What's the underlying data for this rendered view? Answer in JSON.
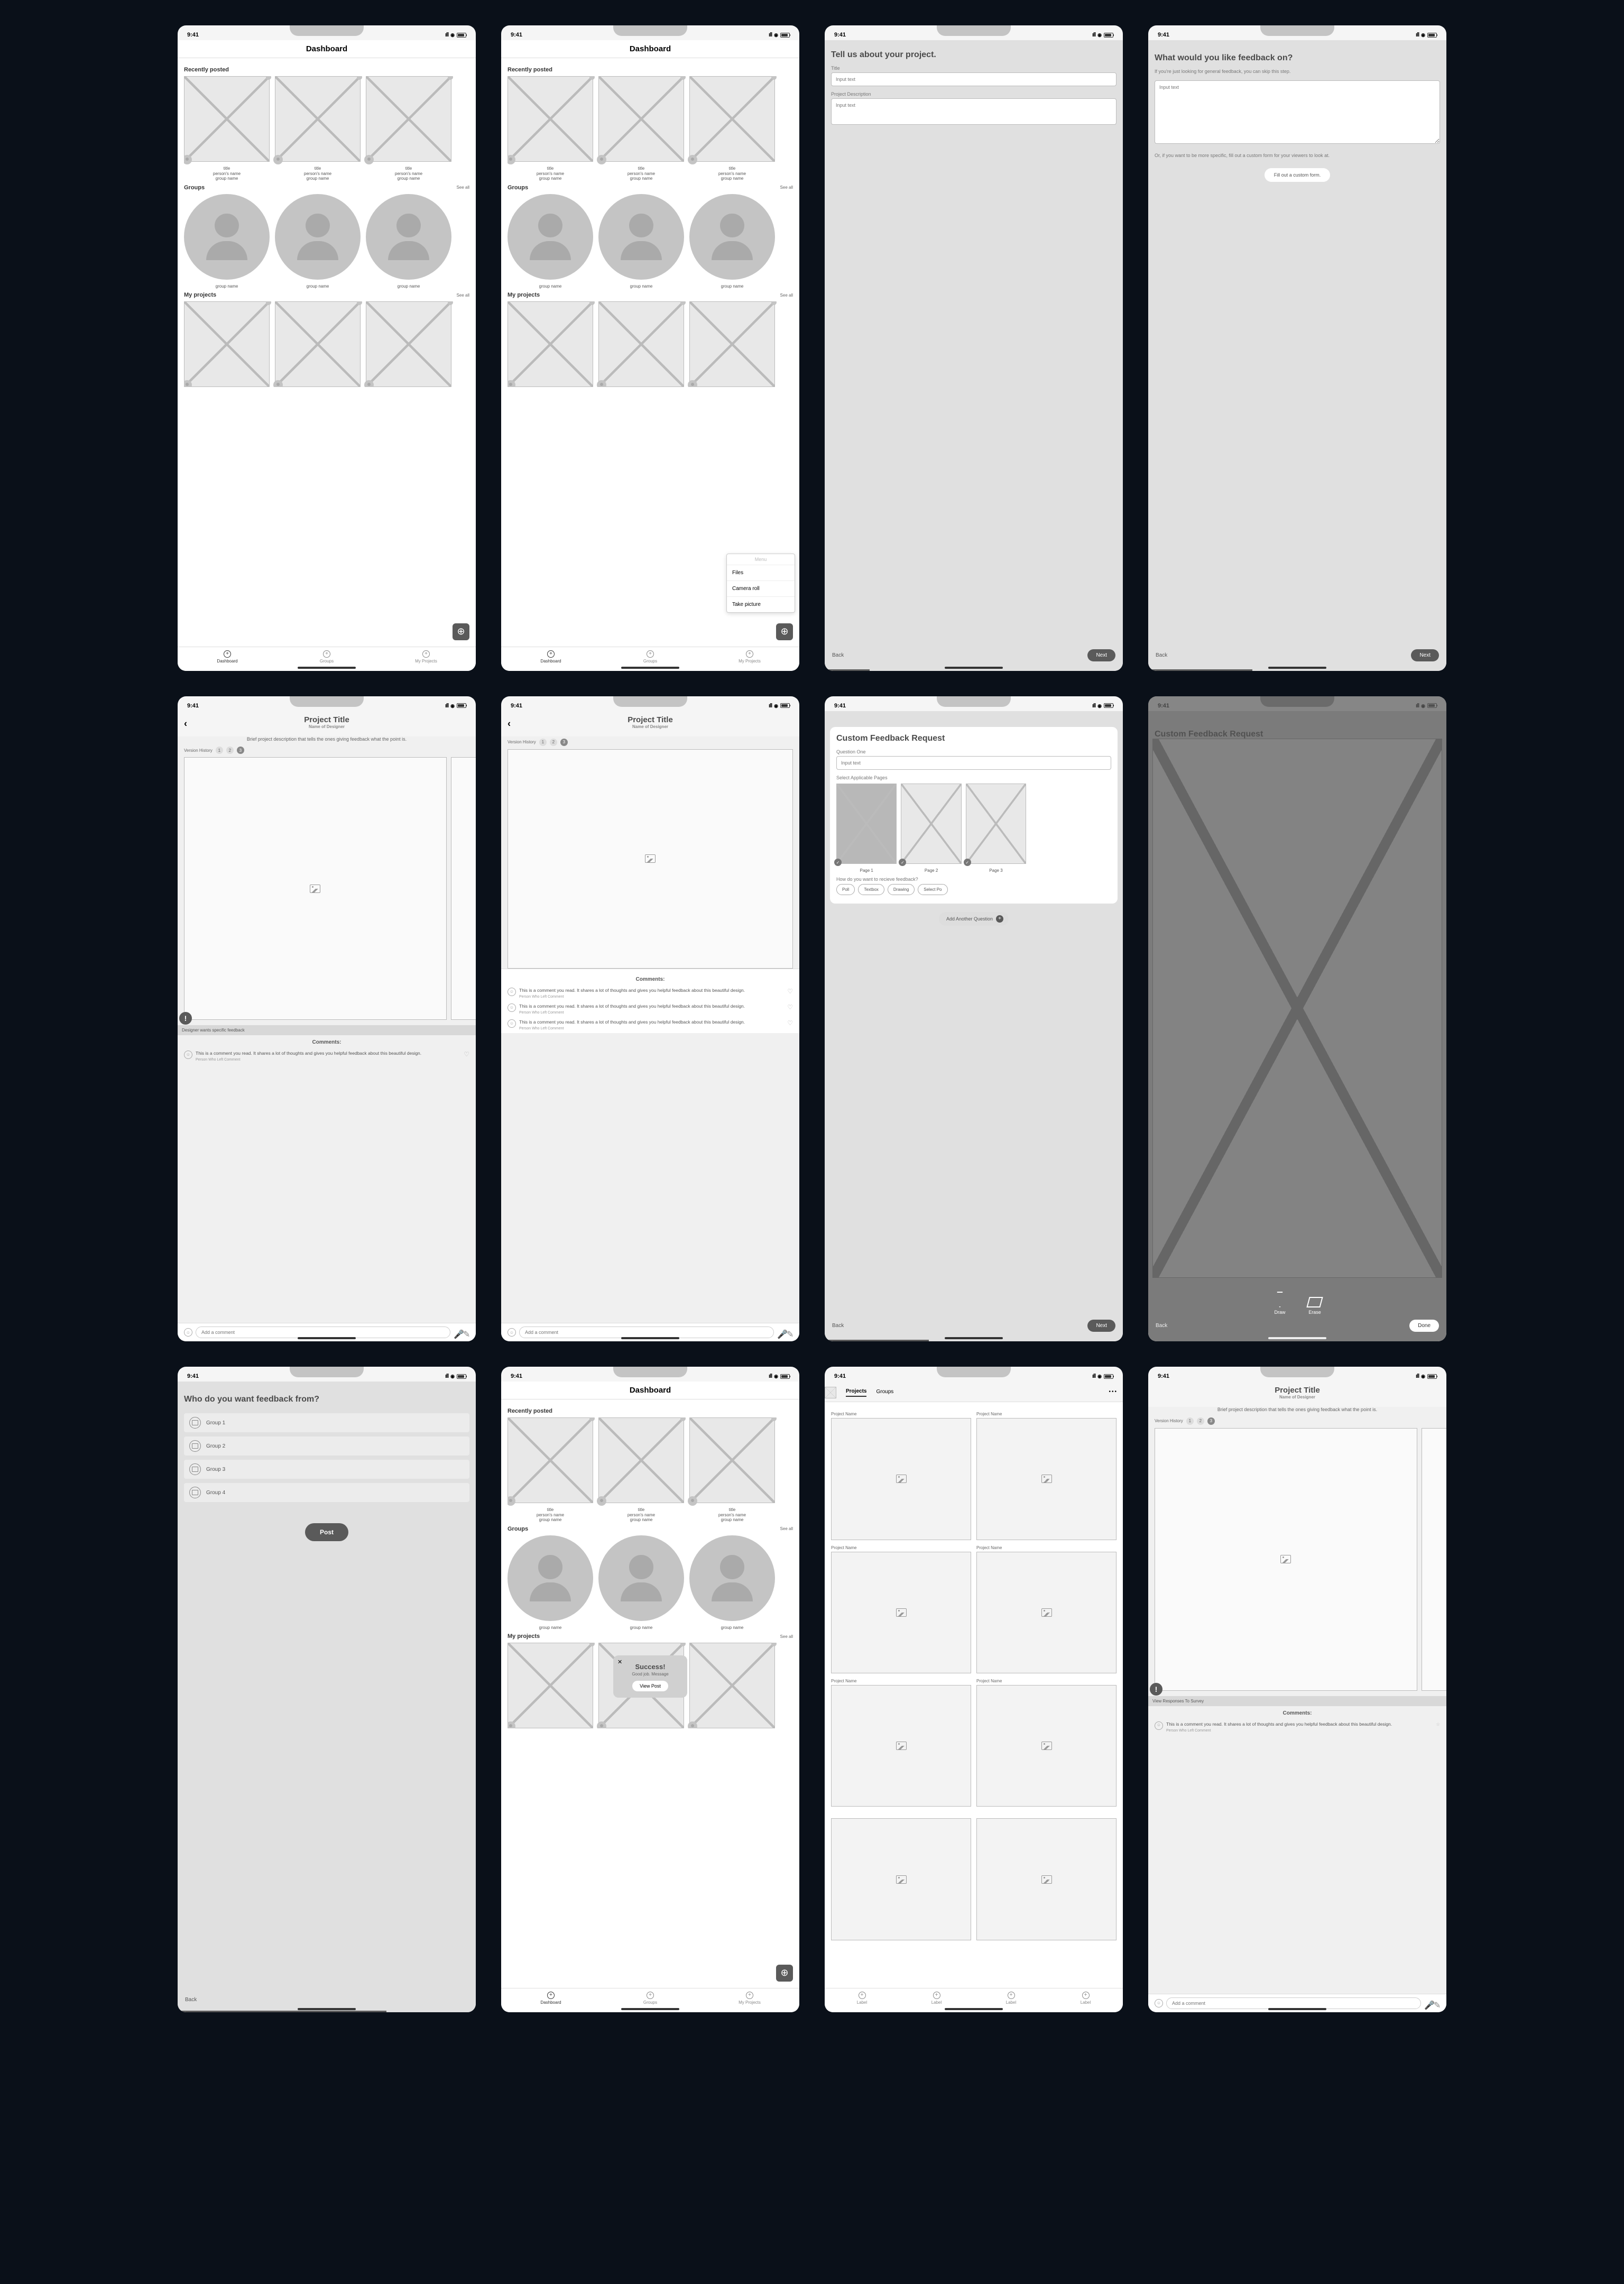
{
  "status_time": "9:41",
  "screens": {
    "s1": {
      "title": "Dashboard",
      "recently": "Recently posted",
      "groups": "Groups",
      "myproj": "My projects",
      "seeall": "See all",
      "card": {
        "t1": "title",
        "t2": "person's name",
        "t3": "group name"
      },
      "groupname": "group name",
      "tabs": [
        "Dashboard",
        "Groups",
        "My Projects"
      ]
    },
    "s2": {
      "menu_header": "Menu",
      "menu": [
        "Files",
        "Camera roll",
        "Take picture"
      ]
    },
    "s3": {
      "h": "Tell us about your project.",
      "title_lbl": "Title",
      "desc_lbl": "Project Description",
      "ph": "Input text",
      "back": "Back",
      "next": "Next"
    },
    "s4": {
      "h": "What would you like feedback on?",
      "sub": "If you're just looking for general feedback, you can skip this step.",
      "ph": "Input text",
      "or": "Or, if you want to be more specific, fill out a custom form for your viewers to look at.",
      "cta": "Fill out a custom form.",
      "back": "Back",
      "next": "Next"
    },
    "s5": {
      "title": "Project Title",
      "designer": "Name of Designer",
      "desc": "Brief project description that tells the ones giving feedback what the point is.",
      "vh": "Version History",
      "versions": [
        "1",
        "2",
        "3"
      ],
      "banner": "Designer wants specific feedback",
      "comments_hdr": "Comments:",
      "comment": "This is a comment you read. It shares a lot of thoughts and gives you helpful feedback about this beautiful design.",
      "author": "Person Who Left Comment",
      "add": "Add a comment"
    },
    "s7": {
      "h": "Custom Feedback Request",
      "q1": "Question One",
      "ph": "Input text",
      "sel": "Select Applicable Pages",
      "pages": [
        "Page 1",
        "Page 2",
        "Page 3"
      ],
      "how": "How do you want to recieve feedback?",
      "chips": [
        "Poll",
        "Textbox",
        "Drawing",
        "Select Po"
      ],
      "addq": "Add Another Question",
      "back": "Back",
      "next": "Next"
    },
    "s8": {
      "draw": "Draw",
      "erase": "Erase",
      "back": "Back",
      "done": "Done"
    },
    "s9": {
      "h": "Who do you want feedback from?",
      "groups": [
        "Group 1",
        "Group 2",
        "Group 3",
        "Group 4"
      ],
      "post": "Post",
      "back": "Back"
    },
    "s10": {
      "toast_h": "Success!",
      "toast_msg": "Good job. Message",
      "toast_btn": "View Post"
    },
    "s11": {
      "seg": [
        "Projects",
        "Groups"
      ],
      "proj": "Project Name",
      "tab": "Label"
    },
    "s12": {
      "banner": "View Responses To Survey"
    }
  }
}
